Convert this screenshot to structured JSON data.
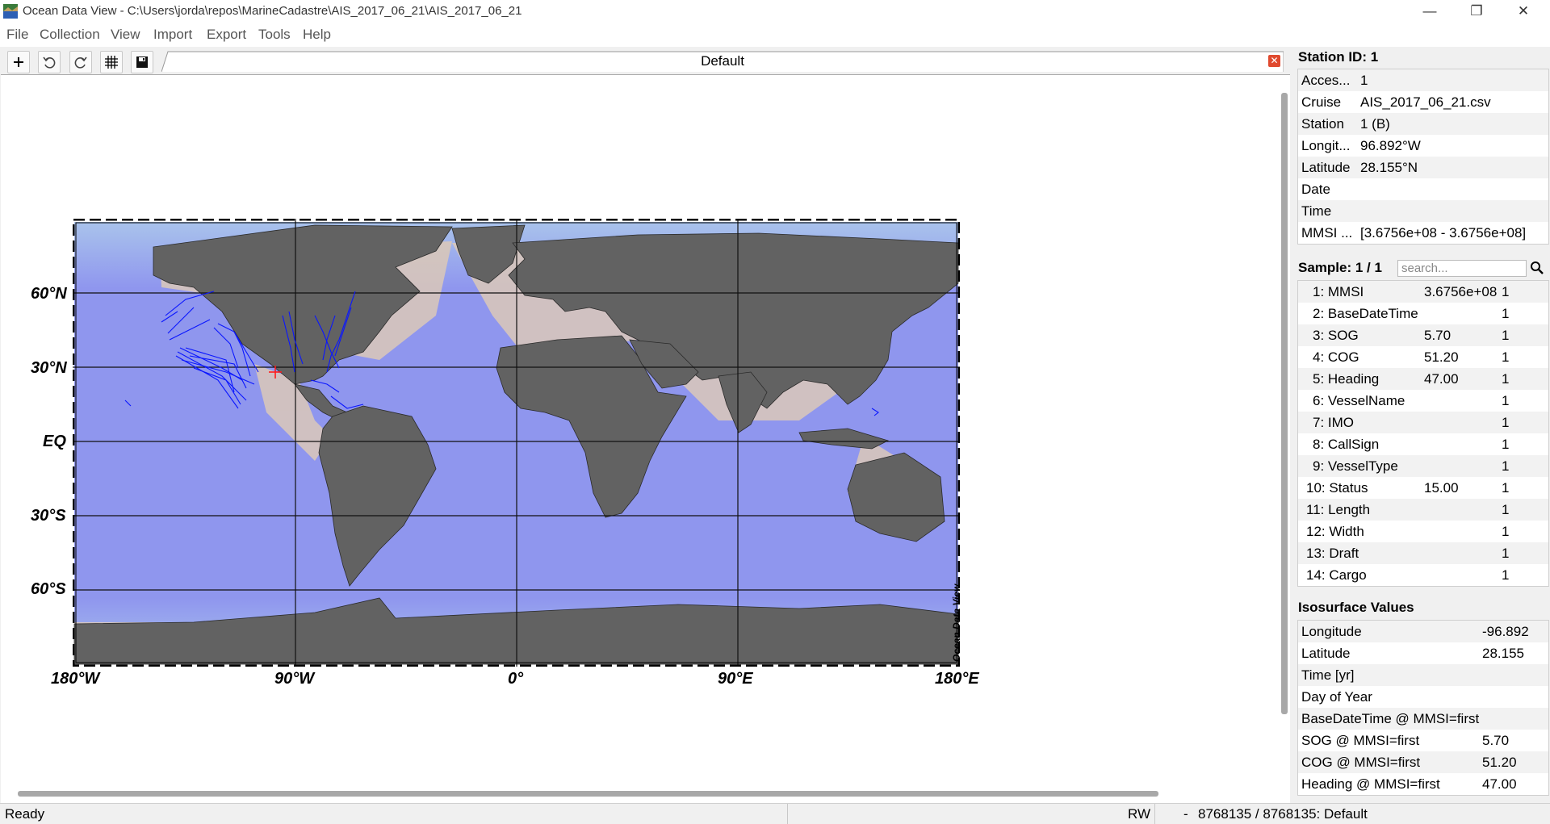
{
  "window": {
    "title": "Ocean Data View - C:\\Users\\jorda\\repos\\MarineCadastre\\AIS_2017_06_21\\AIS_2017_06_21",
    "minimize": "—",
    "restore": "❐",
    "close": "✕"
  },
  "menu": [
    "File",
    "Collection",
    "View",
    "Import",
    "Export",
    "Tools",
    "Help"
  ],
  "toolbar": {
    "buttons": [
      "add-icon",
      "undo-icon",
      "redo-icon",
      "grid-icon",
      "save-icon"
    ]
  },
  "tab": {
    "label": "Default",
    "close": "✕"
  },
  "map": {
    "lat_labels": [
      "60°N",
      "30°N",
      "EQ",
      "30°S",
      "60°S"
    ],
    "lon_labels": [
      "180°W",
      "90°W",
      "0°",
      "90°E",
      "180°E"
    ],
    "watermark": "Ocean Data View",
    "colors": {
      "ocean_deep": "#8b8ff0",
      "ocean_shallow": "#b4c8e4",
      "land": "#626262",
      "shelf": "#dcc9b8",
      "tracks": "#0a16ff",
      "station": "#ff1d1d"
    }
  },
  "station": {
    "header": "Station ID: 1",
    "rows": [
      {
        "key": "Acces...",
        "value": "1"
      },
      {
        "key": "Cruise",
        "value": "AIS_2017_06_21.csv"
      },
      {
        "key": "Station",
        "value": "1 (B)"
      },
      {
        "key": "Longit...",
        "value": "96.892°W"
      },
      {
        "key": "Latitude",
        "value": "28.155°N"
      },
      {
        "key": "Date",
        "value": ""
      },
      {
        "key": "Time",
        "value": ""
      },
      {
        "key": "MMSI ...",
        "value": "[3.6756e+08 - 3.6756e+08]"
      }
    ]
  },
  "sample": {
    "header": "Sample: 1 / 1",
    "search_placeholder": "search...",
    "rows": [
      {
        "name": "1: MMSI",
        "value": "3.6756e+08",
        "flag": "1"
      },
      {
        "name": "2: BaseDateTime",
        "value": "",
        "flag": "1"
      },
      {
        "name": "3: SOG",
        "value": "5.70",
        "flag": "1"
      },
      {
        "name": "4: COG",
        "value": "51.20",
        "flag": "1"
      },
      {
        "name": "5: Heading",
        "value": "47.00",
        "flag": "1"
      },
      {
        "name": "6: VesselName",
        "value": "",
        "flag": "1"
      },
      {
        "name": "7: IMO",
        "value": "",
        "flag": "1"
      },
      {
        "name": "8: CallSign",
        "value": "",
        "flag": "1"
      },
      {
        "name": "9: VesselType",
        "value": "",
        "flag": "1"
      },
      {
        "name": "10: Status",
        "value": "15.00",
        "flag": "1"
      },
      {
        "name": "11: Length",
        "value": "",
        "flag": "1"
      },
      {
        "name": "12: Width",
        "value": "",
        "flag": "1"
      },
      {
        "name": "13: Draft",
        "value": "",
        "flag": "1"
      },
      {
        "name": "14: Cargo",
        "value": "",
        "flag": "1"
      }
    ]
  },
  "isosurface": {
    "header": "Isosurface Values",
    "rows": [
      {
        "key": "Longitude",
        "value": "-96.892"
      },
      {
        "key": "Latitude",
        "value": "28.155"
      },
      {
        "key": "Time [yr]",
        "value": ""
      },
      {
        "key": "Day of Year",
        "value": ""
      },
      {
        "key": "BaseDateTime @ MMSI=first",
        "value": ""
      },
      {
        "key": "SOG @ MMSI=first",
        "value": "5.70"
      },
      {
        "key": "COG @ MMSI=first",
        "value": "51.20"
      },
      {
        "key": "Heading @ MMSI=first",
        "value": "47.00"
      }
    ]
  },
  "status": {
    "left": "Ready",
    "mode": "RW",
    "dash": "-",
    "info": "8768135 / 8768135: Default"
  }
}
